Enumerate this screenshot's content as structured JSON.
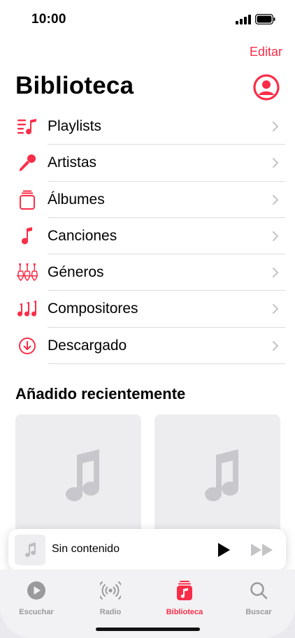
{
  "status_bar": {
    "time": "10:00"
  },
  "header": {
    "edit_label": "Editar",
    "title": "Biblioteca"
  },
  "library_items": [
    {
      "label": "Playlists",
      "icon": "playlists-icon"
    },
    {
      "label": "Artistas",
      "icon": "microphone-icon"
    },
    {
      "label": "Álbumes",
      "icon": "albums-icon"
    },
    {
      "label": "Canciones",
      "icon": "music-note-icon"
    },
    {
      "label": "Géneros",
      "icon": "guitars-icon"
    },
    {
      "label": "Compositores",
      "icon": "notes-icon"
    },
    {
      "label": "Descargado",
      "icon": "download-icon"
    }
  ],
  "recently_added": {
    "title": "Añadido recientemente"
  },
  "mini_player": {
    "title": "Sin contenido"
  },
  "tab_bar": {
    "tabs": [
      {
        "label": "Escuchar",
        "icon": "play-circle-icon",
        "active": false
      },
      {
        "label": "Radio",
        "icon": "radio-icon",
        "active": false
      },
      {
        "label": "Biblioteca",
        "icon": "library-icon",
        "active": true
      },
      {
        "label": "Buscar",
        "icon": "search-icon",
        "active": false
      }
    ]
  },
  "colors": {
    "accent": "#fa2d48",
    "inactive_tab": "#9a9a9d",
    "placeholder": "#ededef"
  }
}
